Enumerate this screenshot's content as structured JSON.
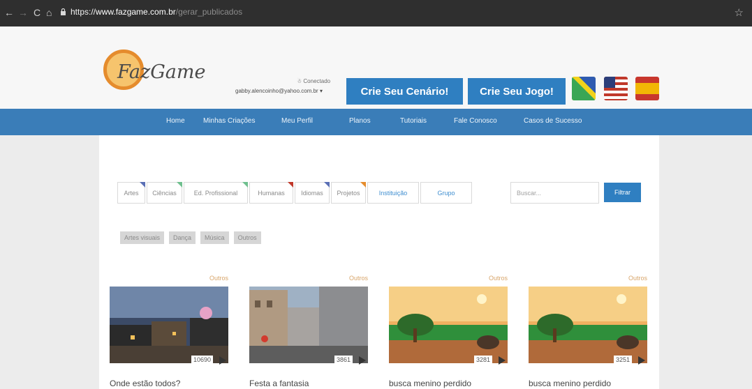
{
  "browser": {
    "back": "←",
    "forward": "→",
    "reload": "C",
    "home": "⌂",
    "url_scheme": "https://",
    "url_host": "www.fazgame.com.br",
    "url_path": "/gerar_publicados"
  },
  "header": {
    "logo_text": "FazGame",
    "user_line1": "Conectado",
    "user_email": "gabby.alencoinho@yahoo.com.br",
    "cta_scenario": "Crie Seu Cenário!",
    "cta_game": "Crie Seu Jogo!"
  },
  "nav": {
    "items": [
      "Home",
      "Minhas Criações",
      "Meu Perfil",
      "Planos",
      "Tutoriais",
      "Fale Conosco",
      "Casos de Sucesso"
    ]
  },
  "filters": {
    "tabs": [
      "Artes",
      "Ciências",
      "Ed. Profissional",
      "Humanas",
      "Idiomas",
      "Projetos",
      "Instituição",
      "Grupo"
    ],
    "search_placeholder": "Buscar...",
    "filter_button": "Filtrar"
  },
  "subtags": [
    "Artes visuais",
    "Dança",
    "Música",
    "Outros"
  ],
  "cards": [
    {
      "category": "Outros",
      "plays": "10690",
      "title": "Onde estão todos?"
    },
    {
      "category": "Outros",
      "plays": "3861",
      "title": "Festa a fantasia"
    },
    {
      "category": "Outros",
      "plays": "3281",
      "title": "busca menino perdido"
    },
    {
      "category": "Outros",
      "plays": "3251",
      "title": "busca menino perdido"
    }
  ],
  "colors": {
    "brand_blue": "#2f7fc1",
    "nav_blue": "#3a7db8",
    "tag_orange": "#d8a56a"
  }
}
